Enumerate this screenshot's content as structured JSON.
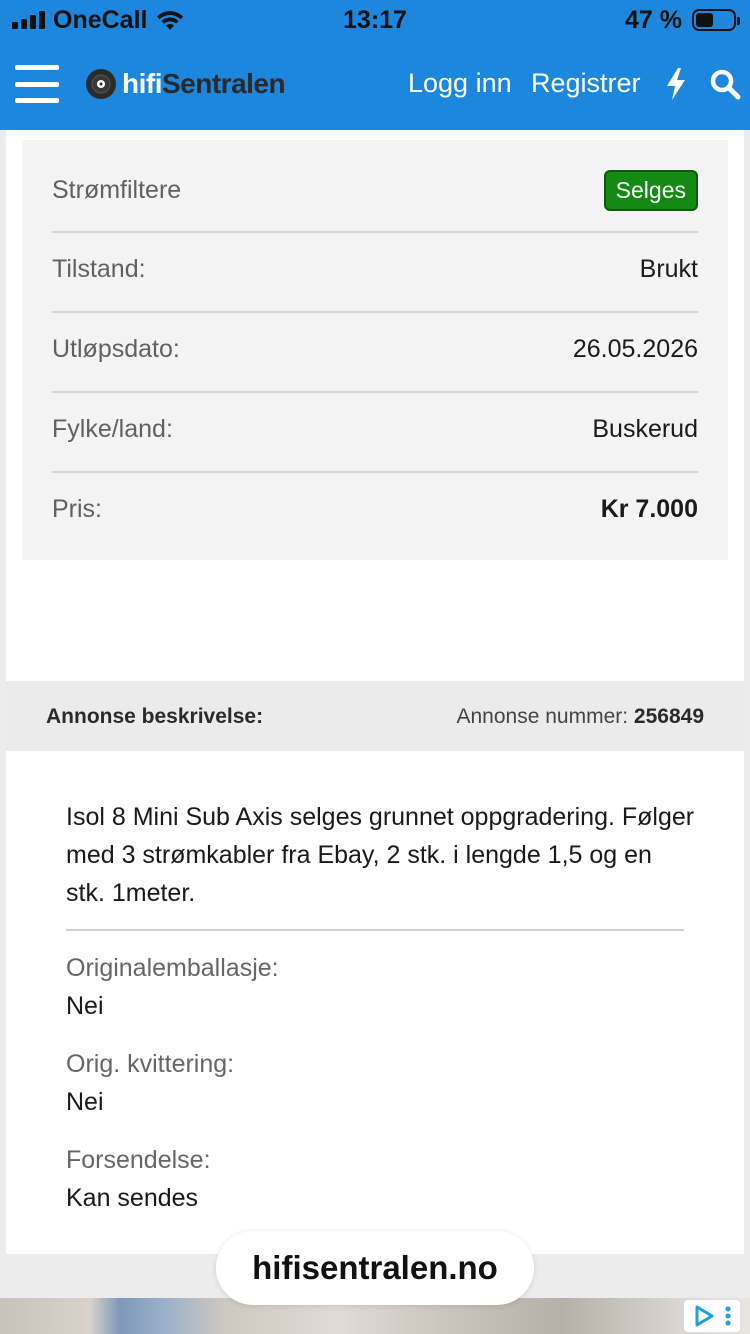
{
  "status_bar": {
    "carrier": "OneCall",
    "time": "13:17",
    "battery_percent": "47 %",
    "battery_level": 0.47
  },
  "navbar": {
    "logo_part1": "hifi",
    "logo_part2": "Sentralen",
    "login": "Logg inn",
    "register": "Registrer",
    "icons": [
      "menu-icon",
      "bolt-icon",
      "search-icon"
    ],
    "colors": {
      "bar": "#1c87dd"
    }
  },
  "info": {
    "category": "Strømfiltere",
    "badge": "Selges",
    "badge_color": "#148a14",
    "rows": [
      {
        "label": "Tilstand:",
        "value": "Brukt"
      },
      {
        "label": "Utløpsdato:",
        "value": "26.05.2026"
      },
      {
        "label": "Fylke/land:",
        "value": "Buskerud"
      },
      {
        "label": "Pris:",
        "value": "Kr 7.000"
      }
    ]
  },
  "description": {
    "title": "Annonse beskrivelse:",
    "number_label": "Annonse nummer:",
    "number": "256849",
    "text": "Isol 8 Mini Sub Axis selges grunnet oppgradering. Følger med 3 strømkabler fra Ebay, 2 stk. i lengde 1,5 og en stk. 1meter.",
    "fields": [
      {
        "label": "Originalemballasje:",
        "value": "Nei"
      },
      {
        "label": "Orig. kvittering:",
        "value": "Nei"
      },
      {
        "label": "Forsendelse:",
        "value": "Kan sendes"
      }
    ]
  },
  "browser": {
    "url": "hifisentralen.no"
  }
}
